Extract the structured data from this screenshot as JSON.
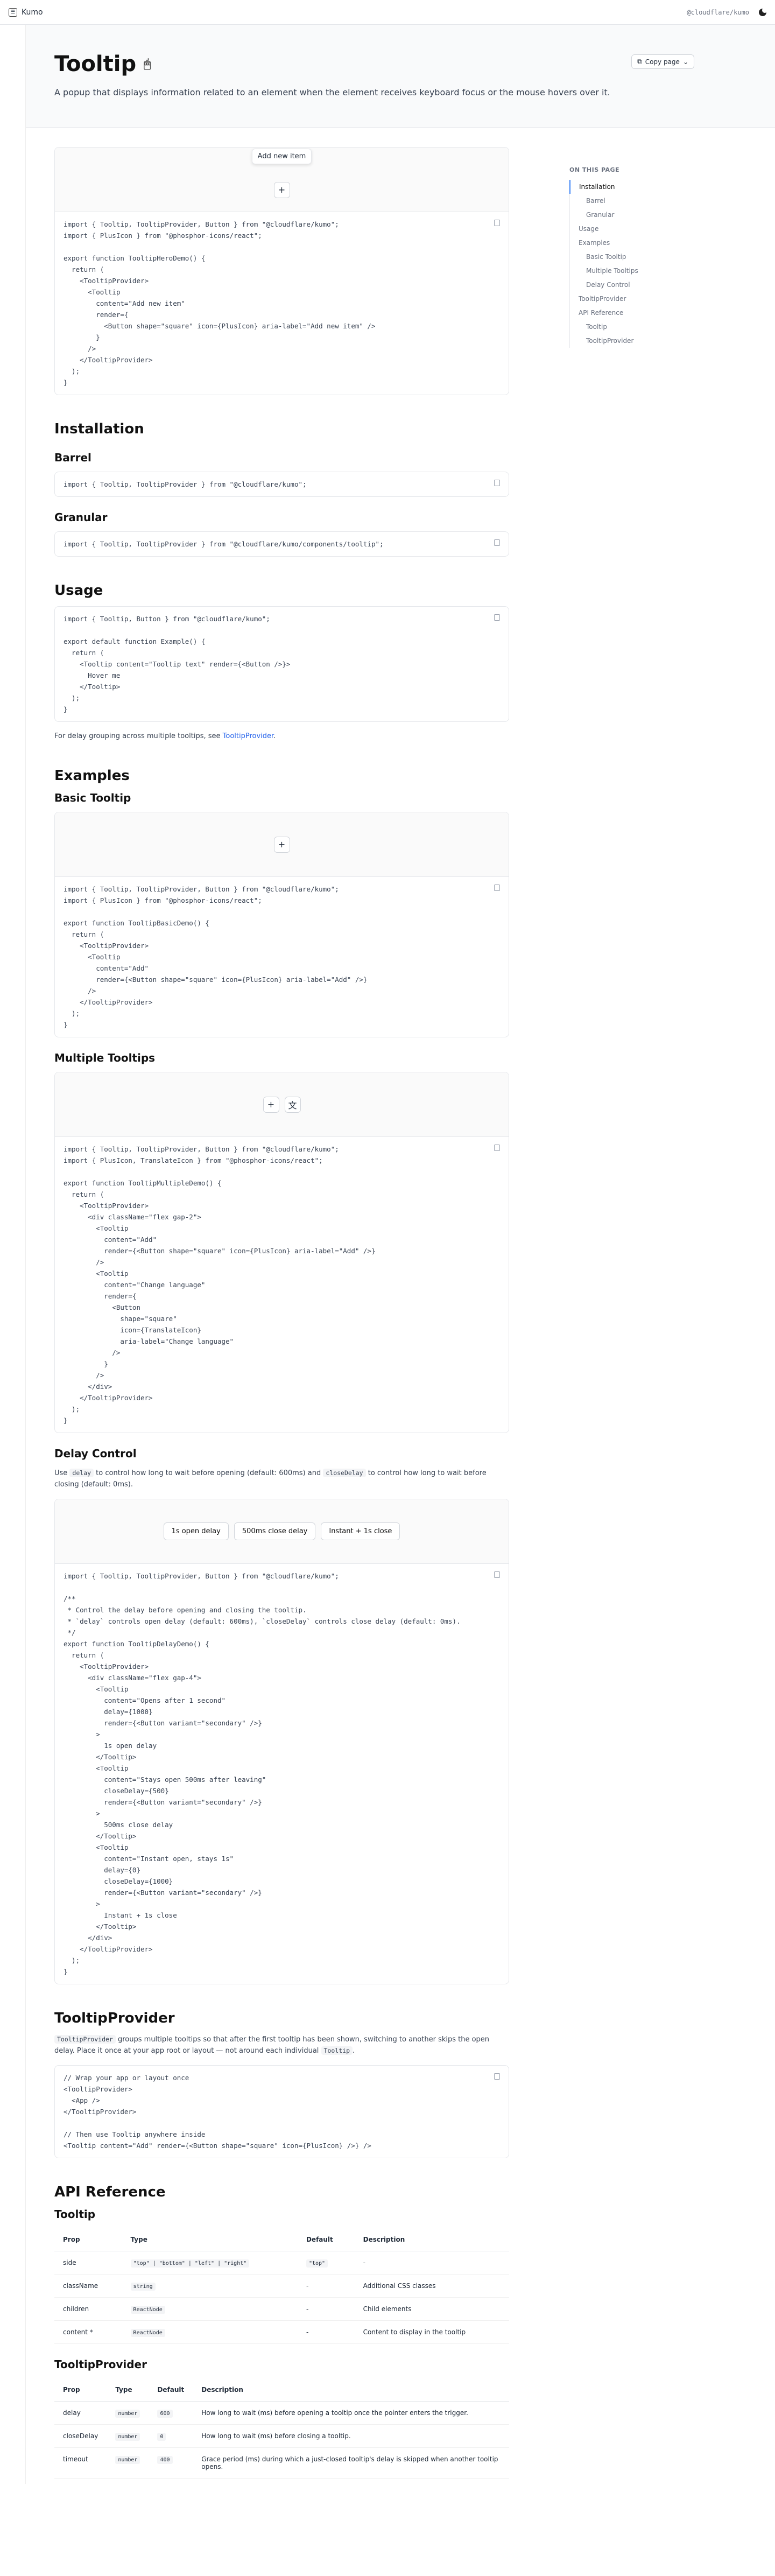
{
  "app": {
    "title": "Kumo",
    "pkg": "@cloudflare/kumo"
  },
  "hero": {
    "title": "Tooltip",
    "subtitle": "A popup that displays information related to an element when the element receives keyboard focus or the mouse hovers over it.",
    "copy_label": "Copy page",
    "icons": [
      "cursor-icon",
      "hand-icon"
    ]
  },
  "toc": {
    "heading": "ON THIS PAGE",
    "items": [
      "Installation",
      "Barrel",
      "Granular",
      "Usage",
      "Examples",
      "Basic Tooltip",
      "Multiple Tooltips",
      "Delay Control",
      "TooltipProvider",
      "API Reference",
      "Tooltip",
      "TooltipProvider"
    ]
  },
  "hero_demo": {
    "tooltip": "Add new item"
  },
  "code": {
    "hero": "import { Tooltip, TooltipProvider, Button } from \"@cloudflare/kumo\";\nimport { PlusIcon } from \"@phosphor-icons/react\";\n\nexport function TooltipHeroDemo() {\n  return (\n    <TooltipProvider>\n      <Tooltip\n        content=\"Add new item\"\n        render={\n          <Button shape=\"square\" icon={PlusIcon} aria-label=\"Add new item\" />\n        }\n      />\n    </TooltipProvider>\n  );\n}",
    "barrel": "import { Tooltip, TooltipProvider } from \"@cloudflare/kumo\";",
    "granular": "import { Tooltip, TooltipProvider } from \"@cloudflare/kumo/components/tooltip\";",
    "usage": "import { Tooltip, Button } from \"@cloudflare/kumo\";\n\nexport default function Example() {\n  return (\n    <Tooltip content=\"Tooltip text\" render={<Button />}>\n      Hover me\n    </Tooltip>\n  );\n}",
    "basic": "import { Tooltip, TooltipProvider, Button } from \"@cloudflare/kumo\";\nimport { PlusIcon } from \"@phosphor-icons/react\";\n\nexport function TooltipBasicDemo() {\n  return (\n    <TooltipProvider>\n      <Tooltip\n        content=\"Add\"\n        render={<Button shape=\"square\" icon={PlusIcon} aria-label=\"Add\" />}\n      />\n    </TooltipProvider>\n  );\n}",
    "multiple": "import { Tooltip, TooltipProvider, Button } from \"@cloudflare/kumo\";\nimport { PlusIcon, TranslateIcon } from \"@phosphor-icons/react\";\n\nexport function TooltipMultipleDemo() {\n  return (\n    <TooltipProvider>\n      <div className=\"flex gap-2\">\n        <Tooltip\n          content=\"Add\"\n          render={<Button shape=\"square\" icon={PlusIcon} aria-label=\"Add\" />}\n        />\n        <Tooltip\n          content=\"Change language\"\n          render={\n            <Button\n              shape=\"square\"\n              icon={TranslateIcon}\n              aria-label=\"Change language\"\n            />\n          }\n        />\n      </div>\n    </TooltipProvider>\n  );\n}",
    "delay": "import { Tooltip, TooltipProvider, Button } from \"@cloudflare/kumo\";\n\n/**\n * Control the delay before opening and closing the tooltip.\n * `delay` controls open delay (default: 600ms), `closeDelay` controls close delay (default: 0ms).\n */\nexport function TooltipDelayDemo() {\n  return (\n    <TooltipProvider>\n      <div className=\"flex gap-4\">\n        <Tooltip\n          content=\"Opens after 1 second\"\n          delay={1000}\n          render={<Button variant=\"secondary\" />}\n        >\n          1s open delay\n        </Tooltip>\n        <Tooltip\n          content=\"Stays open 500ms after leaving\"\n          closeDelay={500}\n          render={<Button variant=\"secondary\" />}\n        >\n          500ms close delay\n        </Tooltip>\n        <Tooltip\n          content=\"Instant open, stays 1s\"\n          delay={0}\n          closeDelay={1000}\n          render={<Button variant=\"secondary\" />}\n        >\n          Instant + 1s close\n        </Tooltip>\n      </div>\n    </TooltipProvider>\n  );\n}",
    "provider": "// Wrap your app or layout once\n<TooltipProvider>\n  <App />\n</TooltipProvider>\n\n// Then use Tooltip anywhere inside\n<Tooltip content=\"Add\" render={<Button shape=\"square\" icon={PlusIcon} />} />"
  },
  "sections": {
    "installation": "Installation",
    "barrel": "Barrel",
    "granular": "Granular",
    "usage": "Usage",
    "examples": "Examples",
    "basic": "Basic Tooltip",
    "multiple": "Multiple Tooltips",
    "delay": "Delay Control",
    "provider": "TooltipProvider",
    "api": "API Reference",
    "api_tooltip": "Tooltip",
    "api_provider": "TooltipProvider"
  },
  "usage_note": {
    "pre": "For delay grouping across multiple tooltips, see ",
    "link": "TooltipProvider",
    "post": "."
  },
  "delay_note": {
    "a": "Use ",
    "c1": "delay",
    "b": " to control how long to wait before opening (default: 600ms) and ",
    "c2": "closeDelay",
    "c": " to control how long to wait before closing (default: 0ms)."
  },
  "delay_buttons": [
    "1s open delay",
    "500ms close delay",
    "Instant + 1s close"
  ],
  "provider_note": {
    "c1": "TooltipProvider",
    "a": " groups multiple tooltips so that after the first tooltip has been shown, switching to another skips the open delay. Place it once at your app root or layout — not around each individual ",
    "c2": "Tooltip",
    "b": "."
  },
  "api_tooltip": {
    "headers": [
      "Prop",
      "Type",
      "Default",
      "Description"
    ],
    "rows": [
      [
        "side",
        "\"top\" | \"bottom\" | \"left\" | \"right\"",
        "\"top\"",
        "-"
      ],
      [
        "className",
        "string",
        "-",
        "Additional CSS classes"
      ],
      [
        "children",
        "ReactNode",
        "-",
        "Child elements"
      ],
      [
        "content *",
        "ReactNode",
        "-",
        "Content to display in the tooltip"
      ]
    ]
  },
  "api_provider": {
    "headers": [
      "Prop",
      "Type",
      "Default",
      "Description"
    ],
    "rows": [
      [
        "delay",
        "number",
        "600",
        "How long to wait (ms) before opening a tooltip once the pointer enters the trigger."
      ],
      [
        "closeDelay",
        "number",
        "0",
        "How long to wait (ms) before closing a tooltip."
      ],
      [
        "timeout",
        "number",
        "400",
        "Grace period (ms) during which a just-closed tooltip's delay is skipped when another tooltip opens."
      ]
    ]
  }
}
